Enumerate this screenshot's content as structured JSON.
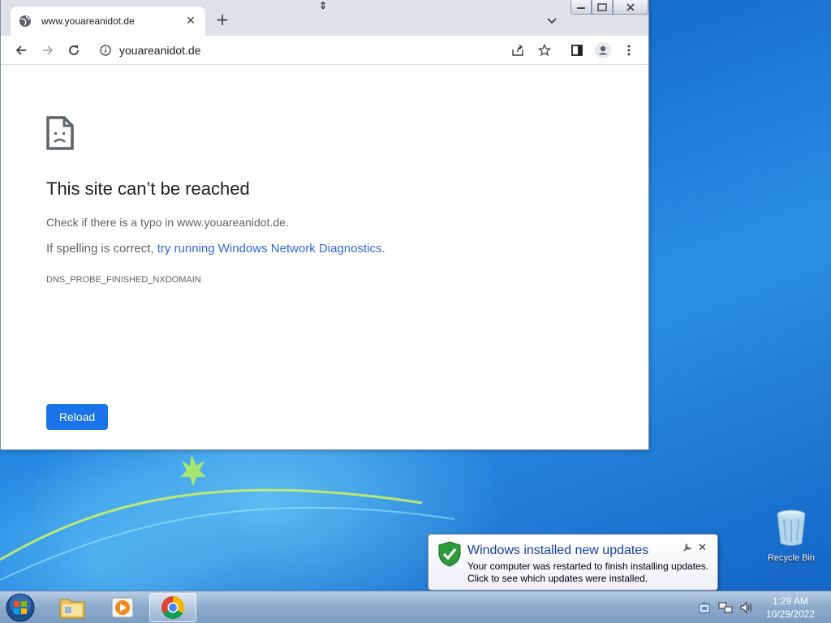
{
  "browser": {
    "tab_title": "www.youareanidot.de",
    "tab_close": "✕",
    "new_tab": "+",
    "url": "youareanidot.de"
  },
  "error_page": {
    "title": "This site can’t be reached",
    "line1": "Check if there is a typo in www.youareanidot.de.",
    "line2_prefix": "If spelling is correct, ",
    "line2_link": "try running Windows Network Diagnostics",
    "line2_suffix": ".",
    "error_code": "DNS_PROBE_FINISHED_NXDOMAIN",
    "reload_label": "Reload"
  },
  "desktop": {
    "recycle_bin_label": "Recycle Bin"
  },
  "notification": {
    "title": "Windows installed new updates",
    "line1": "Your computer was restarted to finish installing updates.",
    "line2": "Click to see which updates were installed.",
    "close": "✕"
  },
  "taskbar": {
    "apps": [
      "windows-explorer",
      "windows-media-player",
      "google-chrome"
    ],
    "time": "1:29 AM",
    "date": "10/29/2022"
  },
  "colors": {
    "accent": "#1a73e8",
    "link": "#3367d6",
    "notification_title": "#1a3e9c"
  }
}
